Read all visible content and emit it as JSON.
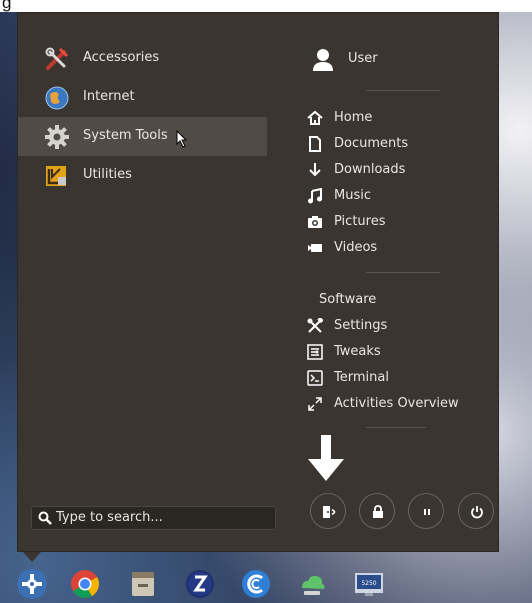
{
  "header_fragment": "g",
  "categories": [
    {
      "label": "Accessories",
      "icon": "accessories-icon"
    },
    {
      "label": "Internet",
      "icon": "internet-globe-icon"
    },
    {
      "label": "System Tools",
      "icon": "gear-icon",
      "active": true
    },
    {
      "label": "Utilities",
      "icon": "utilities-icon"
    }
  ],
  "user": {
    "label": "User"
  },
  "places": [
    {
      "label": "Home",
      "icon": "home-icon"
    },
    {
      "label": "Documents",
      "icon": "document-icon"
    },
    {
      "label": "Downloads",
      "icon": "download-icon"
    },
    {
      "label": "Music",
      "icon": "music-icon"
    },
    {
      "label": "Pictures",
      "icon": "camera-icon"
    },
    {
      "label": "Videos",
      "icon": "video-icon"
    }
  ],
  "software": {
    "header": "Software",
    "items": [
      {
        "label": "Settings",
        "icon": "settings-tools-icon"
      },
      {
        "label": "Tweaks",
        "icon": "tweaks-icon"
      },
      {
        "label": "Terminal",
        "icon": "terminal-icon"
      },
      {
        "label": "Activities Overview",
        "icon": "expand-arrows-icon"
      }
    ]
  },
  "search": {
    "placeholder": "Type to search..."
  },
  "power_buttons": [
    {
      "name": "logout-button",
      "icon": "logout-icon"
    },
    {
      "name": "lock-button",
      "icon": "lock-icon"
    },
    {
      "name": "suspend-button",
      "icon": "pause-icon"
    },
    {
      "name": "power-button",
      "icon": "power-icon"
    }
  ],
  "taskbar": {
    "apps": [
      "menu-launcher-icon",
      "chrome-icon",
      "file-manager-icon",
      "app-z-icon",
      "app-c-icon",
      "weather-icon",
      "monitor-icon"
    ],
    "monitor_text": "5250"
  },
  "colors": {
    "menu_bg": "#3a3530",
    "active_bg": "#514b45",
    "text": "#e9e6e1"
  }
}
